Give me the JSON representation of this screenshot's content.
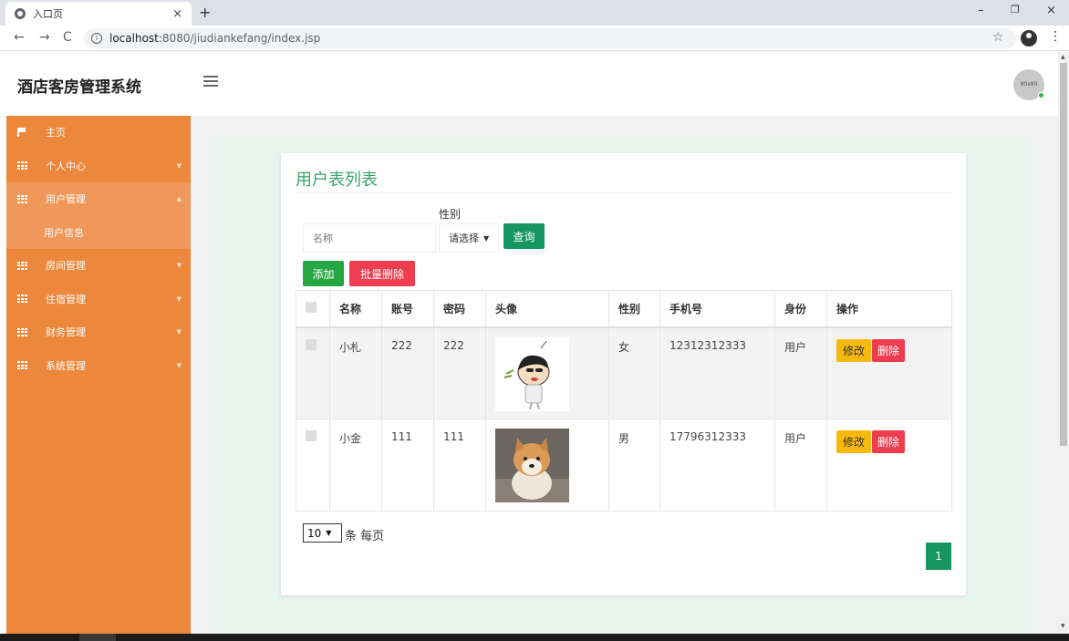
{
  "browser": {
    "tab_title": "入口页",
    "tab_close": "×",
    "new_tab": "+",
    "url_host": "localhost",
    "url_path": ":8080/jiudiankefang/index.jsp",
    "win_minimize": "–",
    "win_restore": "❐",
    "win_close": "×"
  },
  "header": {
    "app_title": "酒店客房管理系统",
    "avatar_text": "80x80"
  },
  "sidebar": {
    "items": [
      {
        "label": "主页",
        "icon": "flag-icon",
        "caret": ""
      },
      {
        "label": "个人中心",
        "icon": "grid-icon",
        "caret": "▼"
      },
      {
        "label": "用户管理",
        "icon": "grid-icon",
        "caret": "▲",
        "open": true
      },
      {
        "label": "房间管理",
        "icon": "grid-icon",
        "caret": "▼"
      },
      {
        "label": "住宿管理",
        "icon": "grid-icon",
        "caret": "▼"
      },
      {
        "label": "财务管理",
        "icon": "grid-icon",
        "caret": "▼"
      },
      {
        "label": "系统管理",
        "icon": "grid-icon",
        "caret": "▼"
      }
    ],
    "sub_item": "用户信息"
  },
  "main": {
    "title": "用户表列表",
    "search": {
      "name_placeholder": "名称",
      "gender_label": "性别",
      "gender_selected": "请选择",
      "query_button": "查询"
    },
    "actions": {
      "add": "添加",
      "batch_delete": "批量删除"
    },
    "table": {
      "headers": [
        "名称",
        "账号",
        "密码",
        "头像",
        "性别",
        "手机号",
        "身份",
        "操作"
      ],
      "rows": [
        {
          "name": "小札",
          "account": "222",
          "password": "222",
          "avatar": "cartoon-boy-image",
          "gender": "女",
          "phone": "12312312333",
          "role": "用户"
        },
        {
          "name": "小金",
          "account": "111",
          "password": "111",
          "avatar": "shiba-dog-image",
          "gender": "男",
          "phone": "17796312333",
          "role": "用户"
        }
      ],
      "edit_label": "修改",
      "delete_label": "删除"
    },
    "pagination": {
      "page_size": "10",
      "page_size_label": "条 每页",
      "current_page": "1"
    }
  },
  "colors": {
    "sidebar": "#ec873b",
    "accent_green": "#15955f",
    "danger": "#ee3d4e",
    "warning": "#f8b90f"
  }
}
